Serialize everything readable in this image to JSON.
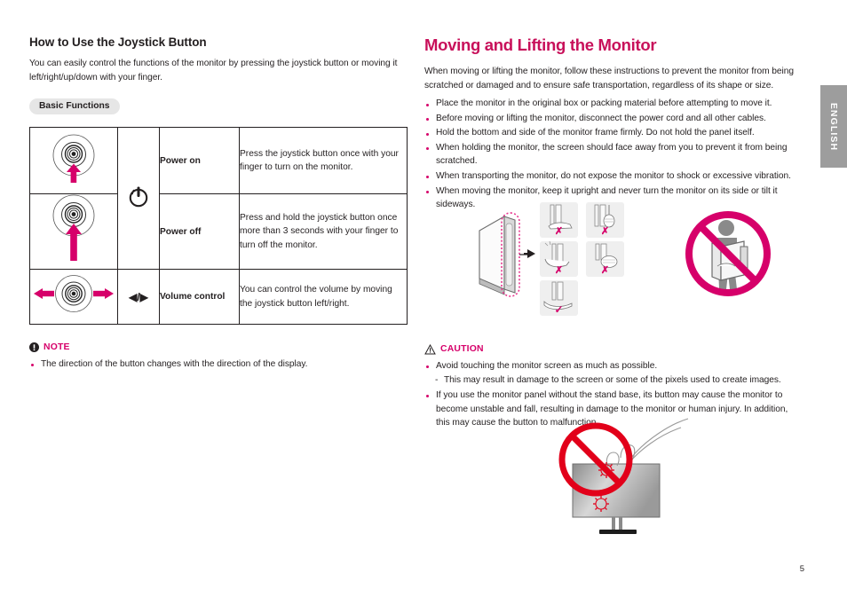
{
  "colors": {
    "brand_pink": "#c8105a",
    "bullet_pink": "#d6006a",
    "text": "#231f20",
    "chip_bg": "#e6e6e6",
    "tab_gray": "#9d9d9d",
    "prohibit_red": "#e2001a"
  },
  "left": {
    "heading": "How to Use the Joystick Button",
    "intro": "You can easily control the functions of the monitor by pressing the joystick button or moving it left/right/up/down with your finger.",
    "chip_label": "Basic Functions",
    "table": {
      "rows": [
        {
          "icon": "joystick-up-arrow",
          "symbol": "power-icon",
          "name": "Power on",
          "desc": "Press the joystick button once with your finger to turn on the monitor."
        },
        {
          "icon": "joystick-up-arrow-long",
          "symbol": "power-icon",
          "name": "Power off",
          "desc": "Press and hold the joystick button once more than 3 seconds with your finger to turn off the monitor."
        },
        {
          "icon": "joystick-left-right-arrows",
          "symbol": "◀/▶",
          "name": "Volume control",
          "desc": "You can control the volume by moving the joystick button left/right."
        }
      ]
    },
    "note": {
      "label": "NOTE",
      "items": [
        "The direction of the button changes with the direction of the display."
      ]
    }
  },
  "right": {
    "heading": "Moving and Lifting the Monitor",
    "intro": "When moving or lifting the monitor, follow these instructions to prevent the monitor from being scratched or damaged and to ensure safe transportation, regardless of its shape or size.",
    "bullets": [
      "Place the monitor in the original box or packing material before attempting to move it.",
      "Before moving or lifting the monitor, disconnect the power cord and all other cables.",
      "Hold the bottom and side of the monitor frame firmly. Do not hold the panel itself.",
      "When holding the monitor, the screen should face away from you to prevent it from being scratched.",
      "When transporting the monitor, do not expose the monitor to shock or excessive vibration.",
      "When moving the monitor, keep it upright and never turn the monitor on its side or tilt it sideways."
    ],
    "illustration_top": {
      "name": "monitor-handling-diagram",
      "hand_cells": [
        {
          "name": "hand-grip-flat-bad",
          "mark": "✗"
        },
        {
          "name": "hand-grip-pinch-bad",
          "mark": "✗"
        },
        {
          "name": "hand-grip-under-bad",
          "mark": "✗"
        },
        {
          "name": "hand-grip-fist-bad",
          "mark": "✗"
        },
        {
          "name": "hand-grip-base-good",
          "mark": "✓"
        }
      ],
      "prohibition": "person-carrying-monitor-facing-body-prohibited"
    },
    "caution": {
      "label": "CAUTION",
      "items": [
        {
          "text": "Avoid touching the monitor screen as much as possible.",
          "level": 0
        },
        {
          "text": "This may result in damage to the screen or some of the pixels used to create images.",
          "level": 1
        },
        {
          "text": "If you use the monitor panel without the stand base, its button may cause the monitor to become unstable and fall, resulting in damage to the monitor or human injury. In addition, this may cause the button to malfunction.",
          "level": 0
        }
      ]
    },
    "illustration_bottom": {
      "name": "do-not-touch-screen-diagram"
    }
  },
  "side_tab": {
    "label": "ENGLISH"
  },
  "page_number": "5"
}
